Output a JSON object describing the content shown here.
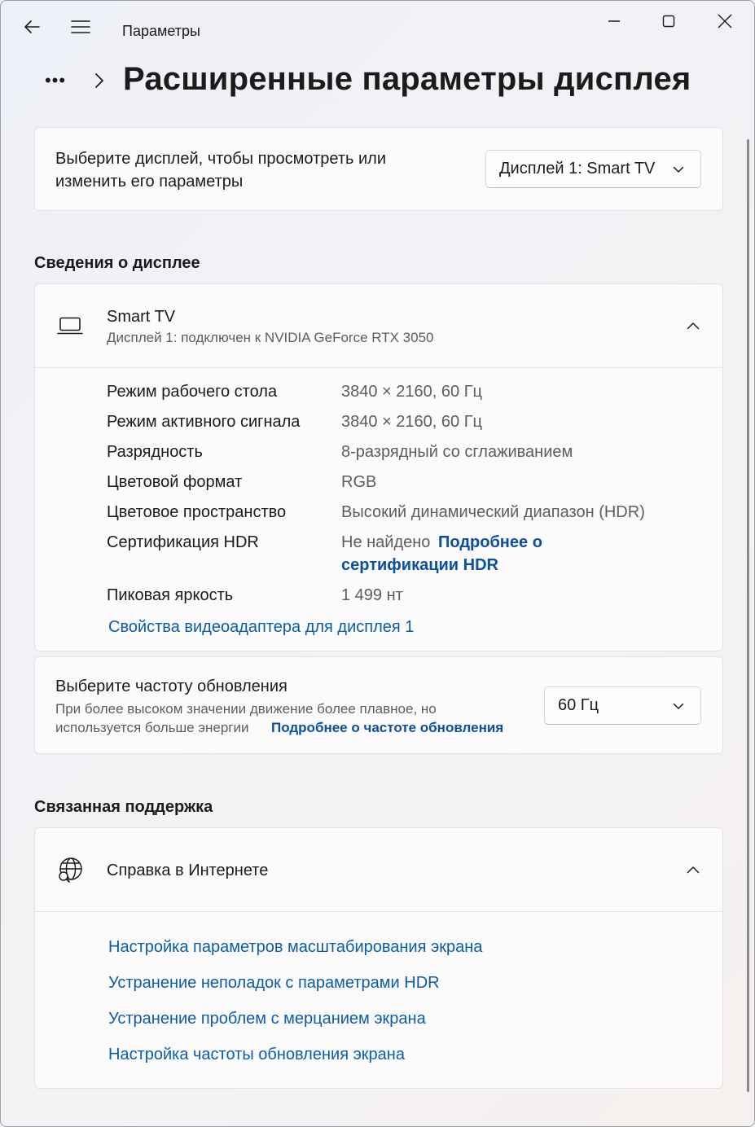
{
  "window": {
    "title": "Параметры",
    "controls": {
      "minimize": "minimize",
      "maximize": "maximize",
      "close": "close"
    }
  },
  "page": {
    "title": "Расширенные параметры дисплея",
    "breadcrumb_more": "•••"
  },
  "display_select": {
    "label": "Выберите дисплей, чтобы просмотреть или изменить его параметры",
    "selected": "Дисплей 1: Smart TV"
  },
  "display_info": {
    "heading": "Сведения о дисплее",
    "name": "Smart TV",
    "subtitle": "Дисплей 1: подключен к NVIDIA GeForce RTX 3050",
    "rows": [
      {
        "label": "Режим рабочего стола",
        "value": "3840 × 2160, 60 Гц"
      },
      {
        "label": "Режим активного сигнала",
        "value": "3840 × 2160, 60 Гц"
      },
      {
        "label": "Разрядность",
        "value": "8-разрядный со сглаживанием"
      },
      {
        "label": "Цветовой формат",
        "value": "RGB"
      },
      {
        "label": "Цветовое пространство",
        "value": "Высокий динамический диапазон (HDR)"
      },
      {
        "label": "Сертификация HDR",
        "value": "Не найдено",
        "link1": "Подробнее о",
        "link2": "сертификации HDR"
      },
      {
        "label": "Пиковая яркость",
        "value": "1 499 нт"
      }
    ],
    "adapter_link": "Свойства видеоадаптера для дисплея 1"
  },
  "refresh": {
    "title": "Выберите частоту обновления",
    "desc_line1": "При более высоком значении движение более плавное, но",
    "desc_line2": "используется больше энергии",
    "link": "Подробнее о частоте обновления",
    "selected": "60 Гц"
  },
  "support": {
    "heading": "Связанная поддержка",
    "card_title": "Справка в Интернете",
    "links": [
      "Настройка параметров масштабирования экрана",
      "Устранение неполадок с параметрами HDR",
      "Устранение проблем с мерцанием экрана",
      "Настройка частоты обновления экрана"
    ]
  },
  "colors": {
    "accent_link": "#0b5cad",
    "card_bg": "#fbfbfb"
  }
}
